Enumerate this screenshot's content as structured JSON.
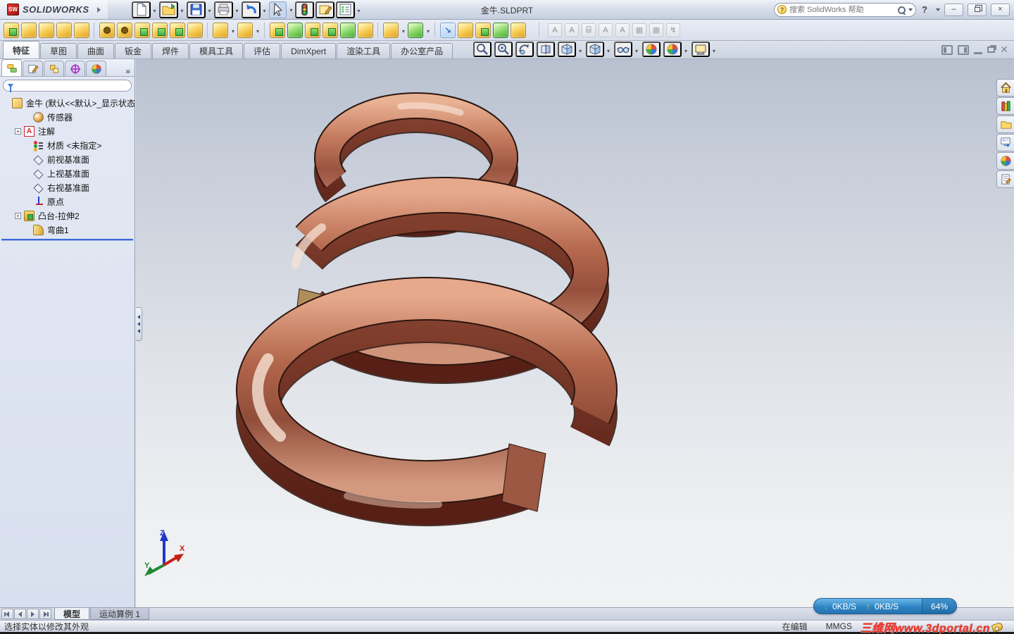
{
  "window": {
    "brand": "SOLIDWORKS",
    "title": "金牛.SLDPRT",
    "search_placeholder": "搜索 SolidWorks 帮助",
    "help_glyph": "?",
    "minimize_glyph": "–",
    "close_glyph": "×"
  },
  "quick_access": [
    {
      "name": "new-document-icon",
      "sym": "s-doc",
      "dd": true
    },
    {
      "name": "open-icon",
      "sym": "s-folder",
      "dd": true
    },
    {
      "name": "save-icon",
      "sym": "s-disk",
      "dd": true
    },
    {
      "name": "print-icon",
      "sym": "s-printer",
      "dd": true
    },
    {
      "name": "undo-icon",
      "sym": "s-undo",
      "dd": true
    },
    {
      "name": "select-cursor-icon",
      "sym": "s-cursor",
      "dd": true,
      "cls": "sel"
    },
    {
      "name": "rebuild-traffic-light-icon",
      "sym": "s-traffic"
    },
    {
      "name": "file-properties-icon",
      "sym": "s-binder"
    },
    {
      "name": "options-list-icon",
      "sym": "s-list",
      "dd": true
    }
  ],
  "feature_tools": [
    {
      "name": "extruded-boss-icon",
      "cls": "v-mix"
    },
    {
      "name": "revolved-boss-icon"
    },
    {
      "name": "swept-boss-icon"
    },
    {
      "name": "lofted-boss-icon"
    },
    {
      "name": "boundary-boss-icon"
    },
    {
      "name": "separator",
      "cls": "sep"
    },
    {
      "name": "extruded-cut-icon",
      "cls": "v-hole"
    },
    {
      "name": "hole-wizard-icon",
      "cls": "v-hole"
    },
    {
      "name": "revolved-cut-icon",
      "cls": "v-mix"
    },
    {
      "name": "swept-cut-icon",
      "cls": "v-mix"
    },
    {
      "name": "lofted-cut-icon",
      "cls": "v-mix"
    },
    {
      "name": "boundary-cut-icon"
    },
    {
      "name": "separator",
      "cls": "sep"
    },
    {
      "name": "fillet-icon",
      "dd": true
    },
    {
      "name": "linear-pattern-icon",
      "dd": true
    },
    {
      "name": "separator",
      "cls": "sep"
    },
    {
      "name": "rib-icon",
      "cls": "v-mix"
    },
    {
      "name": "draft-icon",
      "cls": "v-green"
    },
    {
      "name": "shell-icon",
      "cls": "v-mix"
    },
    {
      "name": "wrap-icon",
      "cls": "v-mix"
    },
    {
      "name": "dome-icon",
      "cls": "v-green"
    },
    {
      "name": "mirror-icon"
    },
    {
      "name": "separator",
      "cls": "sep"
    },
    {
      "name": "reference-geometry-icon",
      "dd": true
    },
    {
      "name": "curves-icon",
      "cls": "v-green",
      "dd": true
    },
    {
      "name": "separator",
      "cls": "sep"
    },
    {
      "name": "instant3d-icon",
      "cls": "pressed"
    },
    {
      "name": "grid-system-icon"
    },
    {
      "name": "library-feature-icon",
      "cls": "v-mix"
    },
    {
      "name": "freeform-icon",
      "cls": "v-green"
    },
    {
      "name": "deform-icon"
    }
  ],
  "annotation_tools": [
    {
      "name": "new-text-icon"
    },
    {
      "name": "edit-text-icon"
    },
    {
      "name": "open-annotation-icon",
      "cls": "gf"
    },
    {
      "name": "add-text-icon"
    },
    {
      "name": "text-pair-icon"
    },
    {
      "name": "save-text-icon",
      "cls": "gd"
    },
    {
      "name": "text-frame-icon",
      "cls": "gd"
    },
    {
      "name": "format-painter-icon",
      "cls": "gw"
    }
  ],
  "command_tabs": [
    {
      "label": "特征",
      "active": true
    },
    {
      "label": "草图"
    },
    {
      "label": "曲面"
    },
    {
      "label": "钣金"
    },
    {
      "label": "焊件"
    },
    {
      "label": "模具工具"
    },
    {
      "label": "评估"
    },
    {
      "label": "DimXpert"
    },
    {
      "label": "渲染工具"
    },
    {
      "label": "办公室产品"
    }
  ],
  "heads_up": [
    {
      "name": "zoom-to-fit-icon",
      "sym": "s-mag"
    },
    {
      "name": "zoom-to-area-icon",
      "sym": "s-magplus"
    },
    {
      "name": "rotate-view-icon",
      "sym": "s-rotate"
    },
    {
      "name": "section-view-icon",
      "sym": "s-section"
    },
    {
      "name": "view-orientation-icon",
      "sym": "s-cube",
      "dd": true
    },
    {
      "name": "display-style-icon",
      "sym": "s-cube",
      "dd": true
    },
    {
      "name": "hide-show-items-icon",
      "sym": "s-glasses",
      "dd": true
    },
    {
      "name": "edit-appearance-icon",
      "sym": "s-ball"
    },
    {
      "name": "apply-scene-icon",
      "sym": "s-ball",
      "dd": true
    },
    {
      "name": "view-settings-icon",
      "sym": "s-monitor",
      "dd": true
    }
  ],
  "doc_window_controls": [
    "pane-left-icon",
    "pane-right-icon",
    "doc-minimize-icon",
    "doc-restore-icon",
    "doc-close-icon"
  ],
  "panel": {
    "tabs": [
      {
        "name": "featuremanager-tab-icon",
        "sym": "s-fm",
        "active": true
      },
      {
        "name": "propertymanager-tab-icon",
        "sym": "s-pm"
      },
      {
        "name": "configurationmanager-tab-icon",
        "sym": "s-cm"
      },
      {
        "name": "dimxpertmanager-tab-icon",
        "sym": "s-dx"
      },
      {
        "name": "displaymanager-tab-icon",
        "sym": "s-ball"
      }
    ],
    "chevron": "»",
    "filter_value": "",
    "tree": [
      {
        "label": "金牛  (默认<<默认>_显示状态",
        "icon": "i-part",
        "cls": "root",
        "name": "tree-root-part"
      },
      {
        "label": "传感器",
        "icon": "i-sensor",
        "name": "tree-item-sensors"
      },
      {
        "label": "注解",
        "icon": "i-note",
        "cls": "has-plus",
        "name": "tree-item-annotations"
      },
      {
        "label": "材质 <未指定>",
        "icon": "i-material",
        "name": "tree-item-material"
      },
      {
        "label": "前视基准面",
        "icon": "i-plane",
        "name": "tree-item-front-plane"
      },
      {
        "label": "上视基准面",
        "icon": "i-plane",
        "name": "tree-item-top-plane"
      },
      {
        "label": "右视基准面",
        "icon": "i-plane",
        "name": "tree-item-right-plane"
      },
      {
        "label": "原点",
        "icon": "i-origin",
        "name": "tree-item-origin"
      },
      {
        "label": "凸台-拉伸2",
        "icon": "i-boss",
        "cls": "has-plus",
        "name": "tree-item-boss-extrude2"
      },
      {
        "label": "弯曲1",
        "icon": "i-flex",
        "name": "tree-item-flex1"
      }
    ]
  },
  "task_pane": [
    {
      "name": "solidworks-resources-icon",
      "sym": "s-house"
    },
    {
      "name": "design-library-icon",
      "sym": "s-books"
    },
    {
      "name": "file-explorer-icon",
      "sym": "s-folder2"
    },
    {
      "name": "view-palette-icon",
      "sym": "s-palette"
    },
    {
      "name": "appearances-scenes-icon",
      "sym": "s-ball"
    },
    {
      "name": "custom-properties-icon",
      "sym": "s-note2"
    }
  ],
  "viewport": {
    "triad": {
      "x": "X",
      "y": "Y",
      "z": "Z"
    }
  },
  "bottom": {
    "tabs": [
      {
        "label": "模型",
        "active": true,
        "name": "tab-model"
      },
      {
        "label": "运动算例 1",
        "name": "tab-motion-study-1"
      }
    ]
  },
  "status": {
    "message": "选择实体以修改其外观",
    "editing": "在编辑",
    "units": "MMGS"
  },
  "net_overlay": {
    "down_label": "0KB/S",
    "up_label": "0KB/S",
    "percent": "64%",
    "down_arrow": "↓",
    "up_arrow": "↑"
  },
  "watermark": {
    "text": "三维网www.3dportal.cn"
  },
  "colors": {
    "copper_mid": "#a85a44",
    "copper_dark": "#6e3526",
    "copper_light": "#eab295",
    "overlay_blue": "#2e84c4",
    "rollback_blue": "#3b6bd6",
    "viewport_top": "#b9c1d0",
    "viewport_bottom": "#f1f2f4"
  }
}
